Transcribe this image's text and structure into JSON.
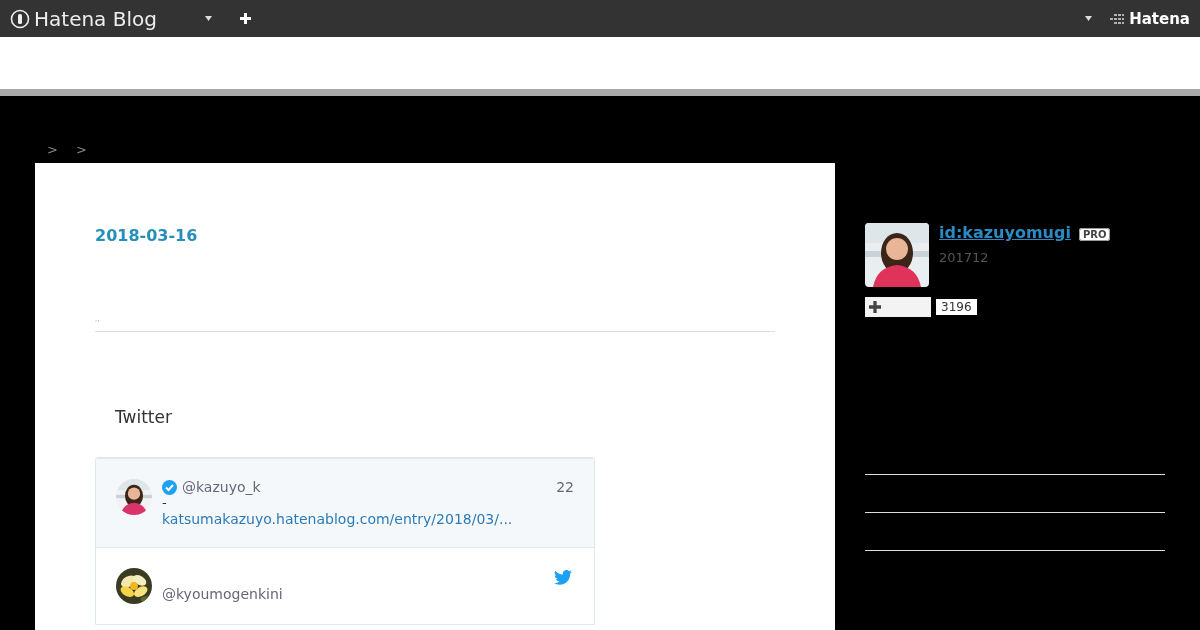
{
  "topbar": {
    "logo": "Hatena Blog",
    "brand": "Hatena"
  },
  "breadcrumb": [
    ">",
    ">"
  ],
  "entry": {
    "date": "2018-03-16",
    "summary": ",,"
  },
  "twitter": {
    "title": "Twitter",
    "tweets": [
      {
        "handle": "@kazuyo_k",
        "verified": true,
        "time": "22",
        "line": "-",
        "link": "katsumakazuyo.hatenablog.com/entry/2018/03/...",
        "highlighted": true
      },
      {
        "handle": "@kyoumogenkini",
        "verified": false,
        "highlighted": false
      }
    ]
  },
  "profile": {
    "id": "id:kazuyomugi",
    "badge": "PRO",
    "since": "201712",
    "readers": "3196"
  }
}
